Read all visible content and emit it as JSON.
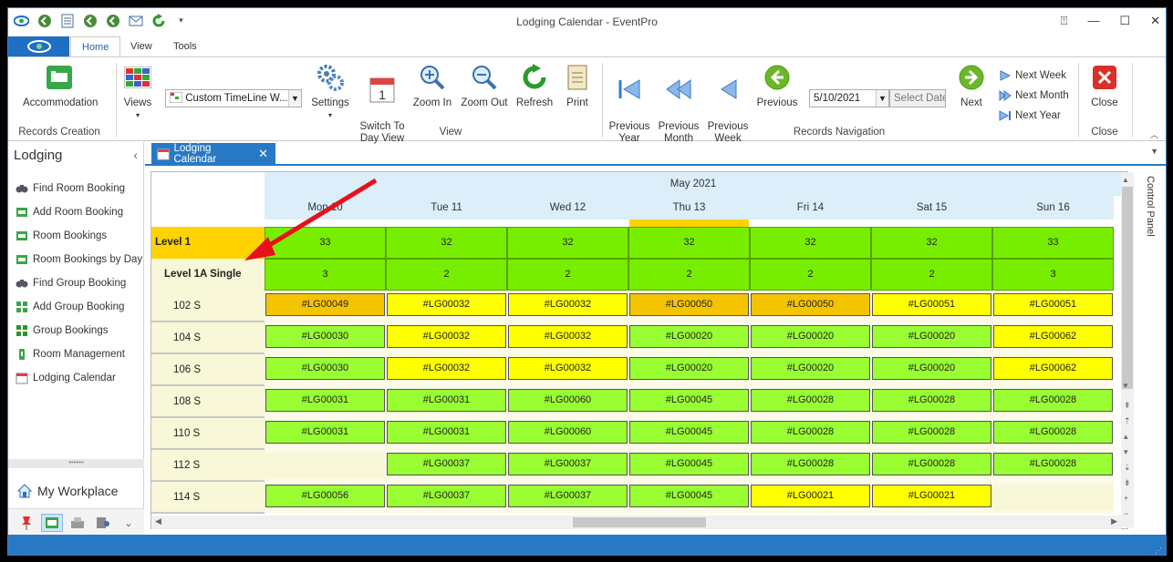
{
  "window": {
    "title": "Lodging Calendar - EventPro"
  },
  "ribbon_tabs": [
    "Home",
    "View",
    "Tools"
  ],
  "ribbon": {
    "accommodation": "Accommodation",
    "records_creation": "Records Creation",
    "views": "Views",
    "view_combo": "Custom TimeLine W...",
    "settings": "Settings",
    "switch_to_day_view": "Switch To\nDay View",
    "zoom_in": "Zoom In",
    "zoom_out": "Zoom Out",
    "refresh": "Refresh",
    "print": "Print",
    "view_group": "View",
    "previous_year": "Previous\nYear",
    "previous_month": "Previous\nMonth",
    "previous_week": "Previous\nWeek",
    "previous": "Previous",
    "date_value": "5/10/2021",
    "select_date": "Select Date",
    "next": "Next",
    "next_week": "Next Week",
    "next_month": "Next Month",
    "next_year": "Next Year",
    "records_navigation": "Records Navigation",
    "close": "Close",
    "close_group": "Close"
  },
  "nav": {
    "title": "Lodging",
    "items": [
      {
        "label": "Find Room Booking",
        "icon": "binoculars-icon"
      },
      {
        "label": "Add Room Booking",
        "icon": "add-room-icon"
      },
      {
        "label": "Room Bookings",
        "icon": "room-bookings-icon"
      },
      {
        "label": "Room Bookings by Day",
        "icon": "room-bookings-day-icon"
      },
      {
        "label": "Find Group Booking",
        "icon": "binoculars-icon"
      },
      {
        "label": "Add Group Booking",
        "icon": "add-group-icon"
      },
      {
        "label": "Group Bookings",
        "icon": "group-bookings-icon"
      },
      {
        "label": "Room Management",
        "icon": "room-management-icon"
      },
      {
        "label": "Lodging Calendar",
        "icon": "calendar-icon"
      }
    ],
    "workplace": "My Workplace"
  },
  "doc_tab": {
    "label": "Lodging Calendar"
  },
  "control_panel": "Control Panel",
  "calendar": {
    "month": "May 2021",
    "days": [
      "Mon 10",
      "Tue 11",
      "Wed 12",
      "Thu 13",
      "Fri 14",
      "Sat 15",
      "Sun 16"
    ],
    "level": {
      "label": "Level 1",
      "counts": [
        "33",
        "32",
        "32",
        "32",
        "32",
        "32",
        "33"
      ]
    },
    "room_type": {
      "label": "Level 1A Single",
      "counts": [
        "3",
        "2",
        "2",
        "2",
        "2",
        "2",
        "3"
      ]
    },
    "rooms": [
      {
        "label": "102 S",
        "bookings": [
          "#LG00049",
          "#LG00032",
          "#LG00032",
          "#LG00050",
          "#LG00050",
          "#LG00051",
          "#LG00051"
        ],
        "colors": [
          "o",
          "y",
          "y",
          "o",
          "o",
          "y",
          "y"
        ]
      },
      {
        "label": "104 S",
        "bookings": [
          "#LG00030",
          "#LG00032",
          "#LG00032",
          "#LG00020",
          "#LG00020",
          "#LG00020",
          "#LG00062"
        ],
        "colors": [
          "g",
          "y",
          "y",
          "g",
          "g",
          "g",
          "y"
        ]
      },
      {
        "label": "106 S",
        "bookings": [
          "#LG00030",
          "#LG00032",
          "#LG00032",
          "#LG00020",
          "#LG00020",
          "#LG00020",
          "#LG00062"
        ],
        "colors": [
          "g",
          "y",
          "y",
          "g",
          "g",
          "g",
          "y"
        ]
      },
      {
        "label": "108 S",
        "bookings": [
          "#LG00031",
          "#LG00031",
          "#LG00060",
          "#LG00045",
          "#LG00028",
          "#LG00028",
          "#LG00028"
        ],
        "colors": [
          "g",
          "g",
          "g",
          "g",
          "g",
          "g",
          "g"
        ]
      },
      {
        "label": "110 S",
        "bookings": [
          "#LG00031",
          "#LG00031",
          "#LG00060",
          "#LG00045",
          "#LG00028",
          "#LG00028",
          "#LG00028"
        ],
        "colors": [
          "g",
          "g",
          "g",
          "g",
          "g",
          "g",
          "g"
        ]
      },
      {
        "label": "112 S",
        "bookings": [
          "",
          "#LG00037",
          "#LG00037",
          "#LG00045",
          "#LG00028",
          "#LG00028",
          "#LG00028"
        ],
        "colors": [
          "n",
          "g",
          "g",
          "g",
          "g",
          "g",
          "g"
        ]
      },
      {
        "label": "114 S",
        "bookings": [
          "#LG00056",
          "#LG00037",
          "#LG00037",
          "#LG00045",
          "#LG00021",
          "#LG00021",
          ""
        ],
        "colors": [
          "g",
          "g",
          "g",
          "g",
          "y",
          "y",
          "n"
        ]
      }
    ],
    "palette": {
      "o": "#f5c400",
      "y": "#ffff00",
      "g": "#99ff33",
      "n": "#f8f7d8",
      "level": "#ffd200",
      "count": "#77ee00"
    }
  }
}
